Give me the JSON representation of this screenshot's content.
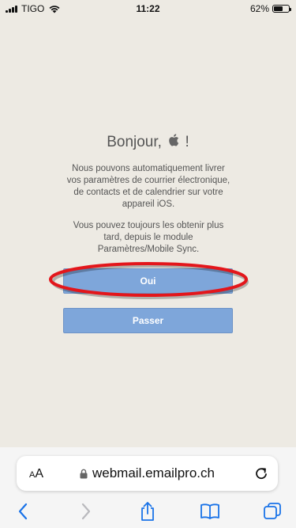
{
  "status_bar": {
    "carrier": "TIGO",
    "time": "11:22",
    "battery_percent": "62%",
    "battery_level": 0.62,
    "signal_bars": 4
  },
  "main": {
    "greeting_prefix": "Bonjour,",
    "greeting_suffix": "!",
    "description_lines": [
      "Nous pouvons automatiquement livrer",
      "vos paramètres de courrier électronique,",
      "de contacts et de calendrier sur votre",
      "appareil iOS."
    ],
    "secondary_lines": [
      "Vous pouvez toujours les obtenir plus",
      "tard, depuis le module",
      "Paramètres/Mobile Sync."
    ],
    "yes_button_label": "Oui",
    "skip_button_label": "Passer",
    "button_color": "#7ea6da",
    "highlight_color": "#e3161b"
  },
  "browser": {
    "text_size_label_small": "A",
    "text_size_label_large": "A",
    "url": "webmail.emailpro.ch",
    "accent_color": "#1a73e8"
  }
}
